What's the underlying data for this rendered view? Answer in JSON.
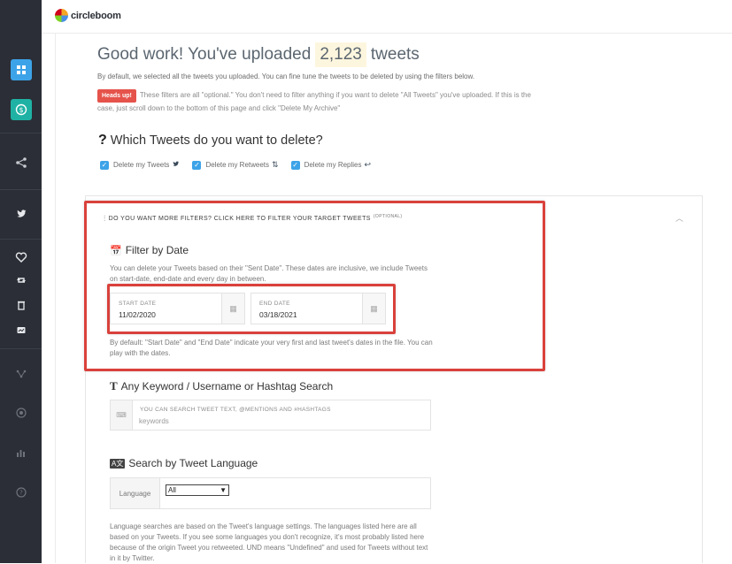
{
  "brand": {
    "logo_text": "circleboom"
  },
  "header": {
    "title_before": "Good work! You've uploaded",
    "tweet_count": "2,123",
    "title_after": "tweets",
    "intro": "By default, we selected all the tweets you uploaded. You can fine tune the tweets to be deleted by using the filters below.",
    "badge": "Heads up!",
    "notice": "These filters are all \"optional.\" You don't need to filter anything if you want to delete \"All Tweets\" you've uploaded. If this is the case, just scroll down to the bottom of this page and click \"Delete My Archive\""
  },
  "question": {
    "mark": "?",
    "title": "Which Tweets do you want to delete?"
  },
  "options": [
    {
      "label": "Delete my Tweets",
      "checked": true,
      "icon": "twitter-bird-icon"
    },
    {
      "label": "Delete my Retweets",
      "checked": true,
      "icon": "retweet-icon"
    },
    {
      "label": "Delete my Replies",
      "checked": true,
      "icon": "reply-icon"
    }
  ],
  "filters": {
    "toggle_label": "DO YOU WANT MORE FILTERS? CLICK HERE TO FILTER YOUR TARGET TWEETS",
    "optional": "(OPTIONAL)",
    "date": {
      "title": "Filter by Date",
      "desc": "You can delete your Tweets based on their \"Sent Date\". These dates are inclusive, we include Tweets on start-date, end-date and every day in between.",
      "start_label": "START DATE",
      "start_value": "11/02/2020",
      "end_label": "END DATE",
      "end_value": "03/18/2021",
      "note": "By default: \"Start Date\" and \"End Date\" indicate your very first and last tweet's dates in the file. You can play with the dates."
    },
    "keyword": {
      "title": "Any Keyword / Username or Hashtag Search",
      "label": "YOU CAN SEARCH TWEET TEXT, @MENTIONS AND #HASHTAGS",
      "placeholder": "keywords"
    },
    "language": {
      "title": "Search by Tweet Language",
      "label": "Language",
      "selected": "All",
      "desc": "Language searches are based on the Tweet's language settings. The languages listed here are all based on your Tweets. If you see some languages you don't recognize, it's most probably listed here because of the origin Tweet you retweeted. UND means \"Undefined\" and used for Tweets without text in it by Twitter."
    }
  },
  "colors": {
    "accent": "#3da3e8",
    "highlight": "#d9413b",
    "sidebar": "#2b2e36",
    "badge": "#e5534b"
  },
  "sidebar_icons": [
    "dashboard-icon",
    "dollar-icon",
    "share-icon",
    "twitter-icon",
    "heart-icon",
    "retweet-icon",
    "trash-icon",
    "archive-icon",
    "network-icon",
    "target-icon",
    "analytics-icon",
    "help-icon"
  ]
}
